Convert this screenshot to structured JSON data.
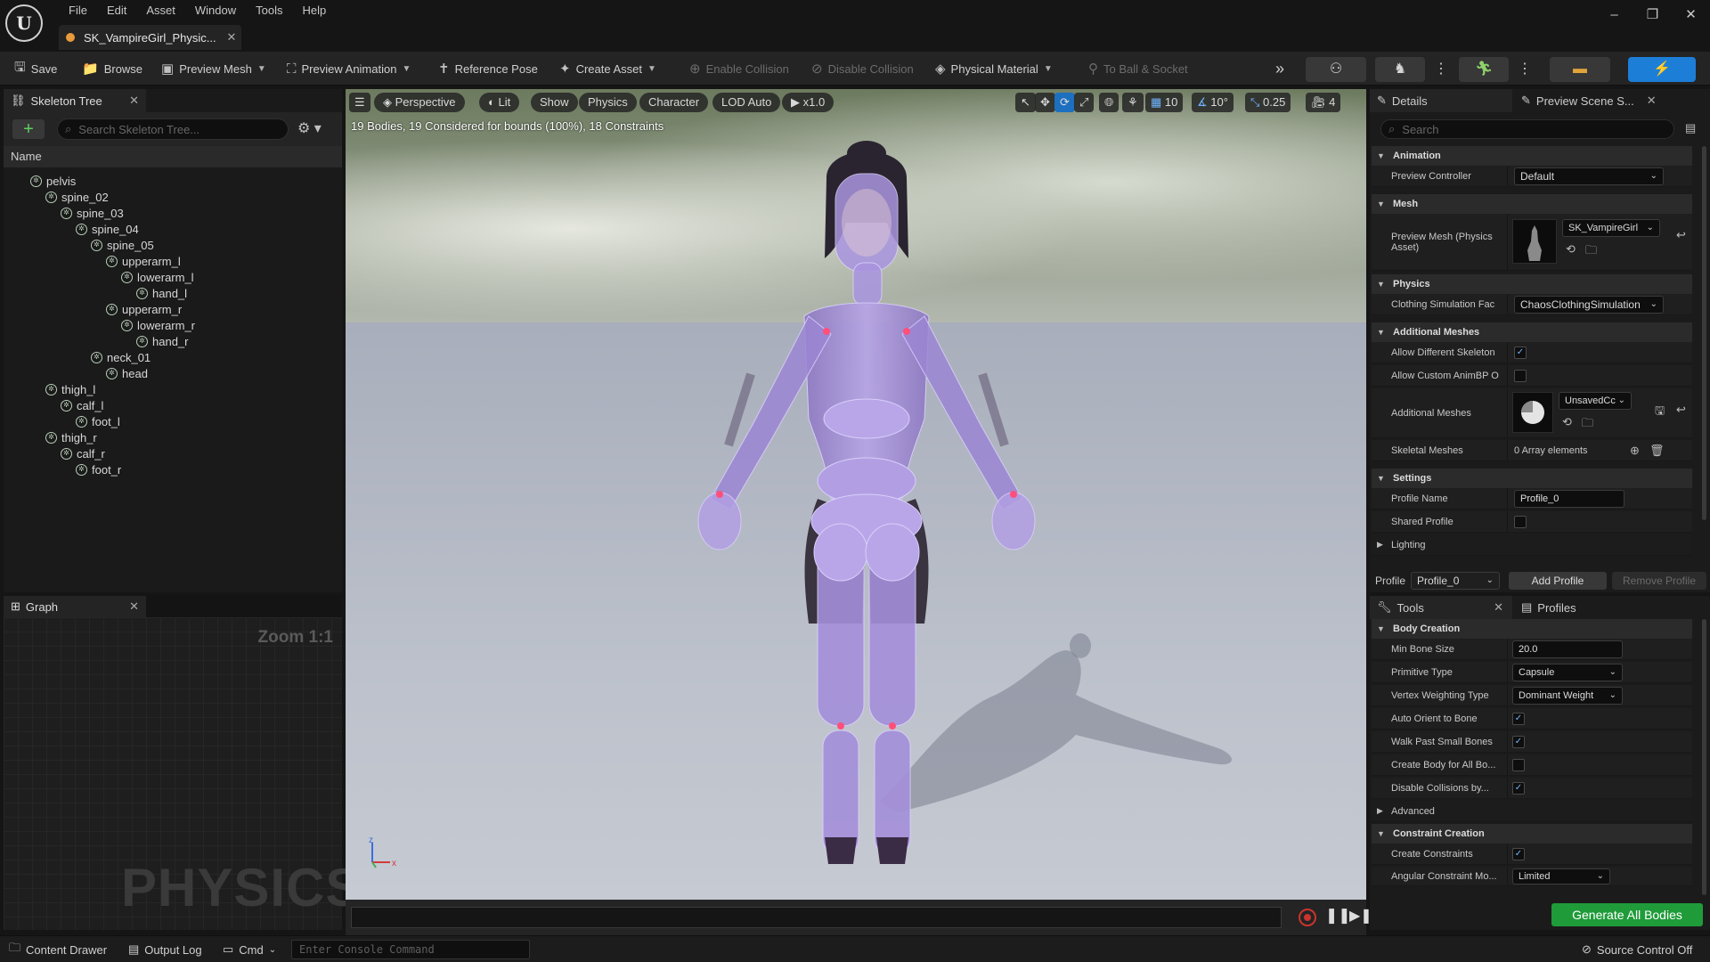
{
  "menu": [
    "File",
    "Edit",
    "Asset",
    "Window",
    "Tools",
    "Help"
  ],
  "asset_tab": {
    "label": "SK_VampireGirl_Physic..."
  },
  "toolbar": {
    "save": "Save",
    "browse": "Browse",
    "preview_mesh": "Preview Mesh",
    "preview_animation": "Preview Animation",
    "reference_pose": "Reference Pose",
    "create_asset": "Create Asset",
    "enable_collision": "Enable Collision",
    "disable_collision": "Disable Collision",
    "physical_material": "Physical Material",
    "to_ball_socket": "To Ball & Socket"
  },
  "skeleton_tree": {
    "title": "Skeleton Tree",
    "search_placeholder": "Search Skeleton Tree...",
    "column": "Name",
    "bones": [
      "pelvis",
      "spine_02",
      "spine_03",
      "spine_04",
      "spine_05",
      "upperarm_l",
      "lowerarm_l",
      "hand_l",
      "upperarm_r",
      "lowerarm_r",
      "hand_r",
      "neck_01",
      "head",
      "thigh_l",
      "calf_l",
      "foot_l",
      "thigh_r",
      "calf_r",
      "foot_r"
    ]
  },
  "graph": {
    "title": "Graph",
    "zoom": "Zoom 1:1",
    "watermark": "PHYSICS"
  },
  "viewport": {
    "perspective": "Perspective",
    "lit": "Lit",
    "show": "Show",
    "physics": "Physics",
    "character": "Character",
    "lod": "LOD Auto",
    "speed": "x1.0",
    "grid": "10",
    "angle": "10°",
    "scale": "0.25",
    "camera_speed": "4",
    "stats": "19 Bodies, 19 Considered for bounds (100%), 18 Constraints",
    "axis_x": "x",
    "axis_z": "z"
  },
  "details": {
    "tab_details": "Details",
    "tab_preview": "Preview Scene S...",
    "search_placeholder": "Search",
    "sections": {
      "animation": "Animation",
      "mesh": "Mesh",
      "physics": "Physics",
      "additional_meshes": "Additional Meshes",
      "settings": "Settings",
      "lighting": "Lighting"
    },
    "preview_controller_label": "Preview Controller",
    "preview_controller_value": "Default",
    "preview_mesh_label": "Preview Mesh (Physics Asset)",
    "preview_mesh_value": "SK_VampireGirl",
    "clothing_label": "Clothing Simulation Fac",
    "clothing_value": "ChaosClothingSimulation",
    "allow_diff_skel_label": "Allow Different Skeleton",
    "allow_diff_skel": true,
    "allow_custom_animbp_label": "Allow Custom AnimBP O",
    "allow_custom_animbp": false,
    "additional_meshes_label": "Additional Meshes",
    "additional_meshes_value": "UnsavedCc",
    "skeletal_meshes_label": "Skeletal Meshes",
    "skeletal_meshes_value": "0 Array elements",
    "profile_name_label": "Profile Name",
    "profile_name_value": "Profile_0",
    "shared_profile_label": "Shared Profile",
    "shared_profile": false
  },
  "profile_bar": {
    "label": "Profile",
    "value": "Profile_0",
    "add": "Add Profile",
    "remove": "Remove Profile"
  },
  "tools": {
    "tab_tools": "Tools",
    "tab_profiles": "Profiles",
    "body_creation": "Body Creation",
    "min_bone_size_label": "Min Bone Size",
    "min_bone_size": "20.0",
    "primitive_type_label": "Primitive Type",
    "primitive_type": "Capsule",
    "vertex_weighting_label": "Vertex Weighting Type",
    "vertex_weighting": "Dominant Weight",
    "auto_orient_label": "Auto Orient to Bone",
    "auto_orient": true,
    "walk_past_label": "Walk Past Small Bones",
    "walk_past": true,
    "create_body_all_label": "Create Body for All Bo...",
    "create_body_all": false,
    "disable_collisions_label": "Disable Collisions by...",
    "disable_collisions": true,
    "advanced": "Advanced",
    "constraint_creation": "Constraint Creation",
    "create_constraints_label": "Create Constraints",
    "create_constraints": true,
    "angular_constraint_label": "Angular Constraint Mo...",
    "angular_constraint": "Limited",
    "generate": "Generate All Bodies"
  },
  "statusbar": {
    "content_drawer": "Content Drawer",
    "output_log": "Output Log",
    "cmd": "Cmd",
    "console_placeholder": "Enter Console Command",
    "source_control": "Source Control Off"
  }
}
